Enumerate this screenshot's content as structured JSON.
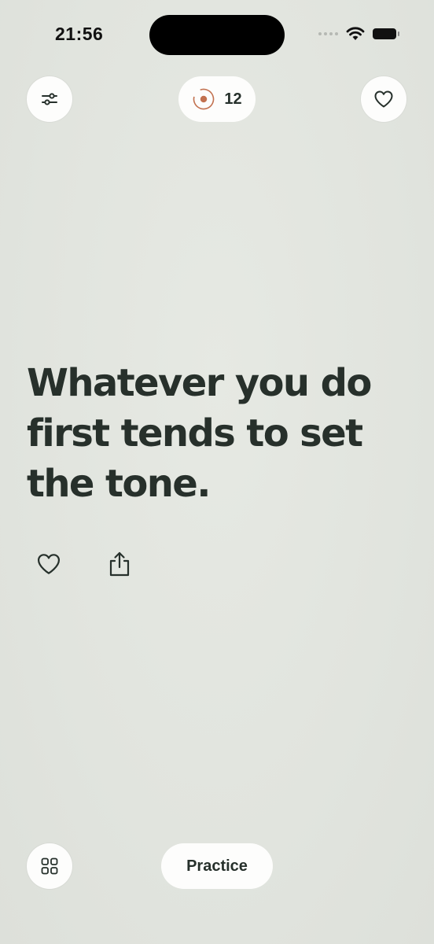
{
  "status_bar": {
    "time": "21:56"
  },
  "top_bar": {
    "filter_icon": "sliders-icon",
    "streak": {
      "icon": "target-ring-icon",
      "count": "12",
      "accent_color": "#c2714f"
    },
    "favorite_icon": "heart-icon"
  },
  "quote": {
    "text": "Whatever you do first tends to set the tone."
  },
  "quote_actions": {
    "like_icon": "heart-icon",
    "share_icon": "share-icon"
  },
  "bottom_bar": {
    "grid_icon": "grid-icon",
    "practice_label": "Practice"
  },
  "colors": {
    "background": "#e3e6e0",
    "text": "#26302b",
    "button_bg": "#fdfdfc"
  }
}
